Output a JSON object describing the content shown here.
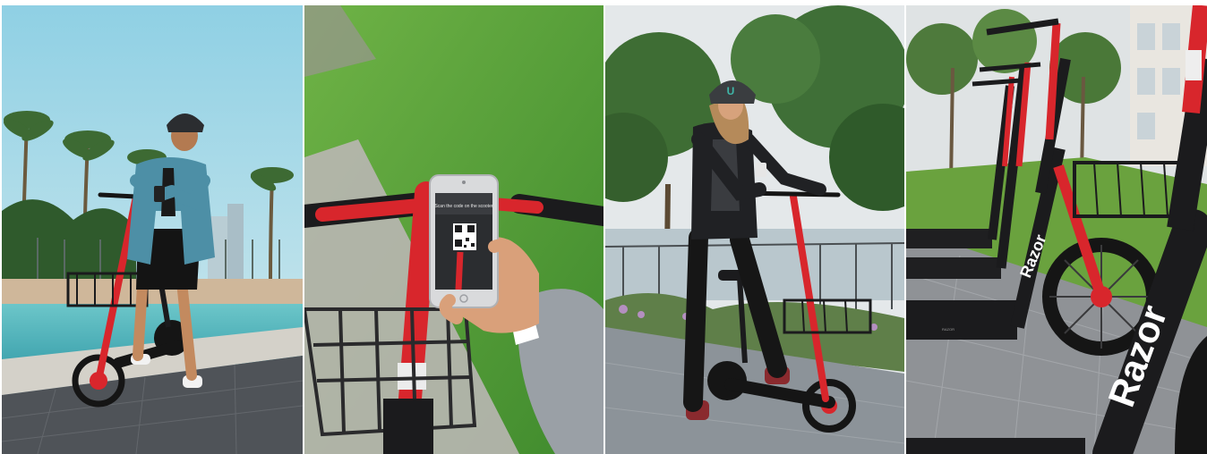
{
  "brand": {
    "wordmark": "Razor",
    "accent_red": "#d8262c",
    "frame_black": "#1b1b1d"
  },
  "phone": {
    "screen_heading": "Scan the code on the scooter"
  },
  "panels": [
    {
      "id": "p1",
      "icon": "photo-rider-with-phone"
    },
    {
      "id": "p2",
      "icon": "photo-phone-scanning-code"
    },
    {
      "id": "p3",
      "icon": "photo-rider-standing"
    },
    {
      "id": "p4",
      "icon": "photo-parked-scooters"
    }
  ]
}
